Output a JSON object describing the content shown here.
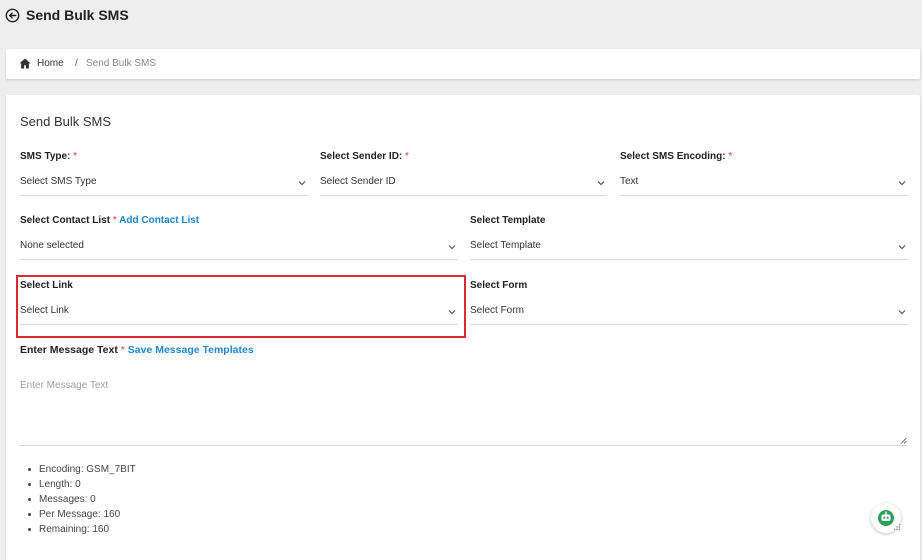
{
  "page": {
    "title": "Send Bulk SMS"
  },
  "breadcrumb": {
    "home": "Home",
    "separator": "/",
    "current": "Send Bulk SMS"
  },
  "form": {
    "title": "Send Bulk SMS",
    "sms_type": {
      "label": "SMS Type:",
      "required": "*",
      "value": "Select SMS Type"
    },
    "sender_id": {
      "label": "Select Sender ID:",
      "required": "*",
      "value": "Select Sender ID"
    },
    "encoding": {
      "label": "Select SMS Encoding:",
      "required": "*",
      "value": "Text"
    },
    "contact_list": {
      "label": "Select Contact List",
      "required": "*",
      "link": "Add Contact List",
      "value": "None selected"
    },
    "template": {
      "label": "Select Template",
      "value": "Select Template"
    },
    "link": {
      "label": "Select Link",
      "value": "Select Link"
    },
    "form_select": {
      "label": "Select Form",
      "value": "Select Form"
    },
    "message": {
      "label": "Enter Message Text",
      "required": "*",
      "link": "Save Message Templates",
      "placeholder": "Enter Message Text"
    },
    "stats": [
      "Encoding: GSM_7BIT",
      "Length: 0",
      "Messages: 0",
      "Per Message: 160",
      "Remaining: 160"
    ]
  },
  "icons": {
    "back": "back-arrow-circle-icon",
    "home": "home-icon",
    "chevron": "chevron-down-icon",
    "chatbot": "chatbot-icon"
  },
  "colors": {
    "highlight": "#d92b34",
    "link": "#1e88c8",
    "required": "#e53935",
    "chatbot": "#2e9e5b"
  }
}
